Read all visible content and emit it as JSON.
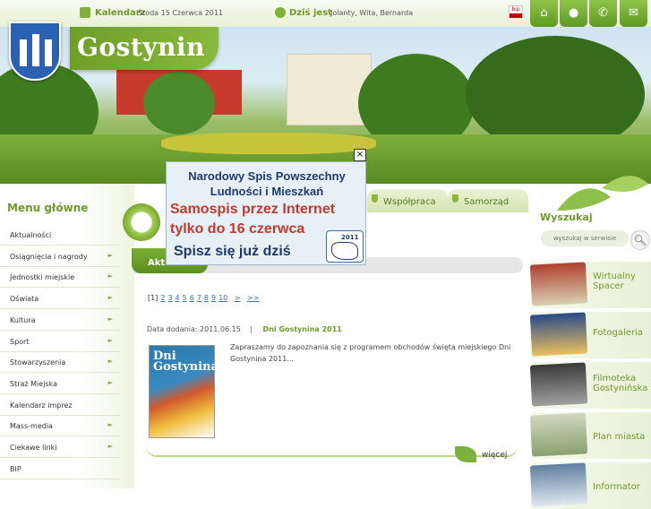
{
  "topbar": {
    "calendar_label": "Kalendarz",
    "calendar_date": "Środa 15 Czerwca 2011",
    "nameday_label": "Dziś jest",
    "nameday_names": "Jolanty, Wita, Bernarda",
    "bip_label": "bip"
  },
  "site": {
    "title": "Gostynin"
  },
  "tabs": [
    {
      "label": "Współpraca"
    },
    {
      "label": "Samorząd"
    }
  ],
  "menu": {
    "title": "Menu główne",
    "items": [
      {
        "label": "Aktualności",
        "arrow": ""
      },
      {
        "label": "Osiągnięcia i nagrody",
        "arrow": "►"
      },
      {
        "label": "Jednostki miejskie",
        "arrow": "►"
      },
      {
        "label": "Oświata",
        "arrow": "►"
      },
      {
        "label": "Kultura",
        "arrow": "►"
      },
      {
        "label": "Sport",
        "arrow": "►"
      },
      {
        "label": "Stowarzyszenia",
        "arrow": "►"
      },
      {
        "label": "Straż Miejska",
        "arrow": "►"
      },
      {
        "label": "Kalendarz imprez",
        "arrow": ""
      },
      {
        "label": "Mass-media",
        "arrow": "►"
      },
      {
        "label": "Ciekawe linki",
        "arrow": "►"
      },
      {
        "label": "BIP",
        "arrow": ""
      }
    ]
  },
  "main": {
    "section_title": "Aktualności",
    "pager": {
      "current": "[1]",
      "pages": [
        "2",
        "3",
        "4",
        "5",
        "6",
        "7",
        "8",
        "9",
        "10"
      ],
      "next": ">",
      "last": ">>"
    },
    "article": {
      "date": "Data dodania: 2011.06.15",
      "separator": "|",
      "title": "Dni Gostynina 2011",
      "thumb_text": "Dni Gostynina",
      "excerpt": "Zapraszamy do zapoznania się z programem obchodów święta miejskiego Dni Gostynina 2011...",
      "more": "więcej"
    }
  },
  "popup": {
    "close": "×",
    "line1": "Narodowy Spis Powszechny",
    "line2": "Ludności i Mieszkań",
    "line3": "Samospis przez Internet",
    "line4": "tylko do 16 czerwca",
    "line5": "Spisz się już dziś",
    "badge_year": "2011"
  },
  "right": {
    "search_title": "Wyszukaj",
    "search_placeholder": "wyszukaj w serwisie",
    "boxes": [
      {
        "label": "Wirtualny Spacer"
      },
      {
        "label": "Fotogaleria"
      },
      {
        "label": "Filmoteka Gostynińska"
      },
      {
        "label": "Plan miasta"
      },
      {
        "label": "Informator"
      }
    ]
  },
  "colors": {
    "accent": "#6e9a2a",
    "popup_red": "#c23a2a",
    "popup_blue": "#1e3a6c"
  },
  "icons": {
    "home": "home-icon",
    "chat": "chat-icon",
    "phone": "phone-icon",
    "mail": "mail-icon",
    "search": "search-icon"
  }
}
